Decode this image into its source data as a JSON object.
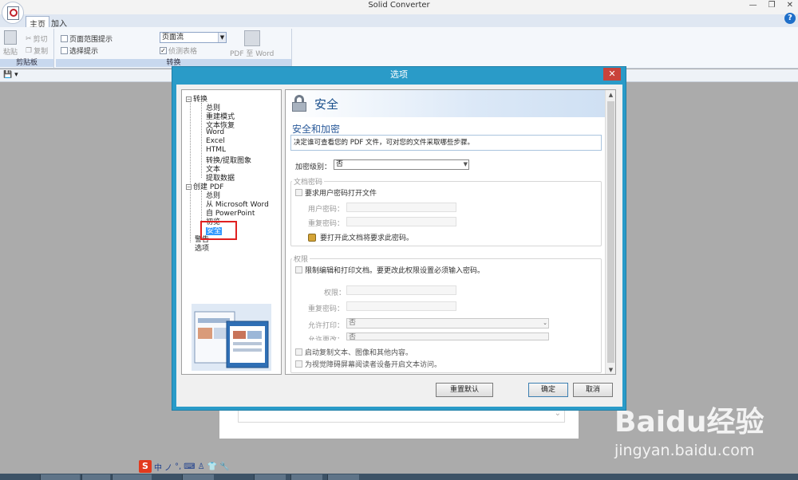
{
  "window": {
    "title": "Solid Converter",
    "controls": [
      "—",
      "❐",
      "✕"
    ],
    "help": "?"
  },
  "ribbon": {
    "tabs": [
      "主页",
      "加入"
    ],
    "clipboard": {
      "paste": "粘贴",
      "cut": "剪切",
      "copy": "复制",
      "label": "剪贴板"
    },
    "convert": {
      "page_range": "页面范围提示",
      "select_prompt": "选择提示",
      "detect_tables": "侦测表格",
      "mode_value": "页面流",
      "pdf_to_word": "PDF 至 Word",
      "label": "转换"
    }
  },
  "dialog": {
    "title": "选项",
    "close": "✕",
    "tree": {
      "convert": "转换",
      "convert_children": [
        "总则",
        "重建模式",
        "文本恢复",
        "Word",
        "Excel",
        "HTML",
        "转换/提取图象",
        "文本",
        "提取数据"
      ],
      "create_pdf": "创建 PDF",
      "create_children": [
        "总则",
        "从 Microsoft Word",
        "自 PowerPoint",
        "初览",
        "安全"
      ],
      "report": "警告",
      "options": "选项"
    },
    "panel": {
      "header_title": "安全",
      "section_title": "安全和加密",
      "description": "决定谁可查看您的 PDF 文件，可对您的文件采取哪些步骤。",
      "encrypt_label": "加密级别：",
      "encrypt_value": "否",
      "doc_password_group": "文档密码",
      "require_open_password": "要求用户密码打开文件",
      "user_password": "用户密码：",
      "repeat_password": "重复密码：",
      "open_note": "要打开此文档将要求此密码。",
      "permissions_group": "权限",
      "restrict_edit_print": "限制编辑和打印文档。要更改此权限设置必须输入密码。",
      "permission_label": "权限：",
      "repeat_password2": "重复密码：",
      "allow_print": "允许打印：",
      "allow_print_value": "否",
      "allow_change": "允许更改：",
      "allow_change_value": "否",
      "enable_copy": "启动复制文本、图像和其他内容。",
      "enable_access": "为视觉障碍屏幕阅读者设备开启文本访问。"
    },
    "buttons": {
      "reset": "重置默认",
      "ok": "确定",
      "cancel": "取消"
    }
  },
  "ime": {
    "logo": "S",
    "mode": "中",
    "items": [
      "ノ",
      "°,",
      "⌨",
      "♙",
      "👕",
      "🔧"
    ]
  },
  "watermark": {
    "logo": "Baidu经验",
    "url": "jingyan.baidu.com"
  },
  "colors": {
    "dialog_frame": "#2a9bc8",
    "close_button": "#c9433b",
    "selection": "#3399ff",
    "highlight_box": "#e02020"
  }
}
